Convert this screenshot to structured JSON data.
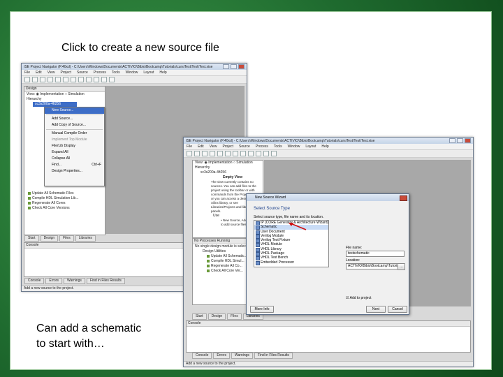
{
  "captions": {
    "top": "Click to create a new source file",
    "bottom_line1": "Can add a schematic",
    "bottom_line2": "to start with…"
  },
  "back_window": {
    "title": "ISE Project Navigator (P.40xd) - C:\\Users\\Windows\\Documents\\ACTIVIO\\Bibio\\Bootcamp\\Tutorials\\cursiTest\\Test\\Test.xise",
    "menu": [
      "File",
      "Edit",
      "View",
      "Project",
      "Source",
      "Process",
      "Tools",
      "Window",
      "Layout",
      "Help"
    ],
    "design_pane": {
      "header": "Design",
      "view_label": "View:",
      "implementation": "Implementation",
      "simulation": "Simulation",
      "hierarchy_label": "Hierarchy",
      "root_item": "xc3s200a-4ft256"
    },
    "context_menu": {
      "items": [
        "New Source...",
        "Add Source...",
        "Add Copy of Source...",
        "Manual Compile Order",
        "Implement Top Module",
        "File/Lib Display",
        "Expand All",
        "Collapse All",
        "Find...",
        "Design Properties..."
      ],
      "selected": "New Source...",
      "find_shortcut": "Ctrl+F"
    },
    "process_rows": [
      "Update All Schematic Files",
      "Compile HDL Simulation Lib...",
      "Regenerate All Cores",
      "Check All Core Versions"
    ],
    "tabs": [
      "Start",
      "Design",
      "Files",
      "Libraries"
    ],
    "console_label": "Console",
    "bottom_tabs": [
      "Console",
      "Errors",
      "Warnings",
      "Find in Files Results"
    ],
    "status": "Add a new source to the project."
  },
  "front_window": {
    "title": "ISE Project Navigator (P.40xd) - C:\\Users\\Windows\\Documents\\ACTIVIO\\Bibio\\Bootcamp\\Tutorials\\cursiTest\\Test\\Test.xise",
    "menu": [
      "File",
      "Edit",
      "View",
      "Project",
      "Source",
      "Process",
      "Tools",
      "Window",
      "Layout",
      "Help"
    ],
    "design_pane": {
      "view_label": "View:",
      "implementation": "Implementation",
      "simulation": "Simulation",
      "hierarchy_label": "Hierarchy",
      "root_item": "xc3s200a-4ft256"
    },
    "empty_view_title": "Empty View",
    "empty_view_text": "The view currently contains no sources. You can add files to the project using the toolbar or with commands from the Project menu, or you can access a design from a Xilinx library, or see Libraries/Projects and libraries panels.",
    "use_label": "Use",
    "use_item": "• New Source, Add Source... to add source files",
    "no_process_text": "No single design module is selected.",
    "process_header": "Design Utilities",
    "process_rows": [
      "Update All Schematic...",
      "Compile HDL Simul...",
      "Regenerate All Co...",
      "Check All Core Ver..."
    ],
    "tabs": [
      "Start",
      "Design",
      "Files",
      "Libraries"
    ],
    "processes_label": "No Processes Running",
    "console_label": "Console",
    "bottom_tabs": [
      "Console",
      "Errors",
      "Warnings",
      "Find in Files Results"
    ],
    "status": "Add a new source to the project."
  },
  "dialog": {
    "title": "New Source Wizard",
    "heading": "Select Source Type",
    "instruction": "Select source type, file name and its location.",
    "source_types": [
      "IP (CORE Generator & Architecture Wizard)",
      "Schematic",
      "User Document",
      "Verilog Module",
      "Verilog Test Fixture",
      "VHDL Module",
      "VHDL Library",
      "VHDL Package",
      "VHDL Test Bench",
      "Embedded Processor"
    ],
    "selected_type": "Schematic",
    "file_name_label": "File name:",
    "file_name_value": "testschematic",
    "location_label": "Location:",
    "location_value": "ACTIVIO\\Bibio\\Bootcamp\\Tutorials\\cursiTest\\Test",
    "add_to_project": "Add to project",
    "more_info": "More Info",
    "next": "Next",
    "cancel": "Cancel",
    "arrow_color": "#d01010"
  }
}
